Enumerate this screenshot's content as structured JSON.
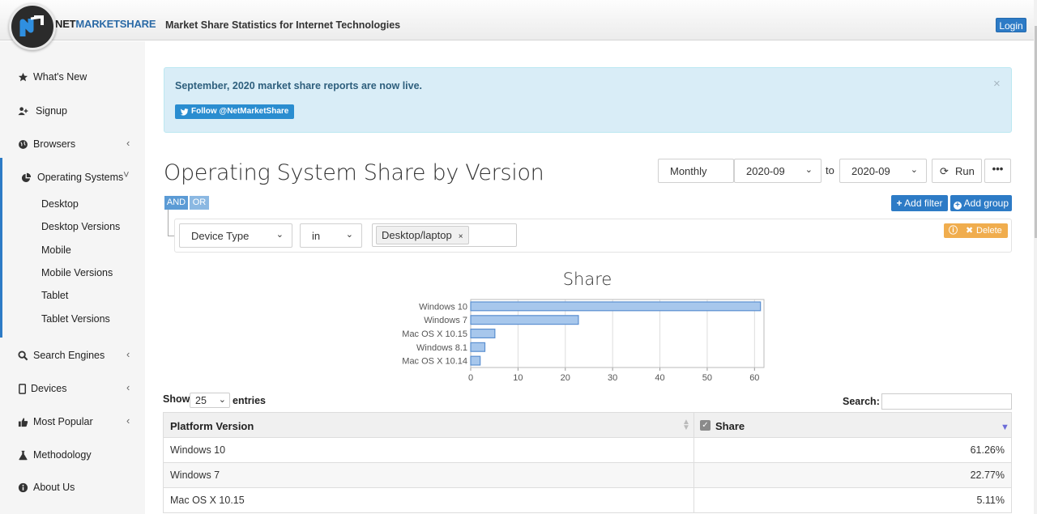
{
  "header": {
    "logo_net": "NET",
    "logo_ms": "MARKETSHARE",
    "tagline": "Market Share Statistics for Internet Technologies",
    "login": "Login"
  },
  "sidebar": {
    "items": [
      {
        "label": "What's New",
        "icon": "star-icon"
      },
      {
        "label": "Signup",
        "icon": "user-plus-icon"
      },
      {
        "label": "Browsers",
        "icon": "globe-icon"
      },
      {
        "label": "Operating Systems",
        "icon": "pie-chart-icon"
      },
      {
        "label": "Search Engines",
        "icon": "search-icon"
      },
      {
        "label": "Devices",
        "icon": "tablet-icon"
      },
      {
        "label": "Most Popular",
        "icon": "thumbs-up-icon"
      },
      {
        "label": "Methodology",
        "icon": "flask-icon"
      },
      {
        "label": "About Us",
        "icon": "info-icon"
      }
    ],
    "os_subitems": [
      "Desktop",
      "Desktop Versions",
      "Mobile",
      "Mobile Versions",
      "Tablet",
      "Tablet Versions"
    ]
  },
  "alert": {
    "message": "September, 2020 market share reports are now live.",
    "follow": "Follow @NetMarketShare",
    "close": "×"
  },
  "report": {
    "title": "Operating System Share by Version",
    "period": "Monthly",
    "from": "2020-09",
    "to_label": "to",
    "to": "2020-09",
    "run": "Run",
    "more": "•••"
  },
  "filter": {
    "and": "AND",
    "or": "OR",
    "add_filter": "Add filter",
    "add_group": "Add group",
    "field": "Device Type",
    "operator": "in",
    "value_tag": "Desktop/laptop",
    "tag_remove": "×",
    "delete": "Delete"
  },
  "chart_data": {
    "type": "bar",
    "orientation": "horizontal",
    "title": "Share",
    "categories": [
      "Windows 10",
      "Windows 7",
      "Mac OS X 10.15",
      "Windows 8.1",
      "Mac OS X 10.14"
    ],
    "values": [
      61.26,
      22.77,
      5.11,
      3.0,
      2.0
    ],
    "xlim": [
      0,
      62
    ],
    "xticks": [
      0,
      10,
      20,
      30,
      40,
      50,
      60
    ],
    "grid": true,
    "color": "#a7c7ec",
    "edge_color": "#5b8fd0"
  },
  "table": {
    "show_label": "Show",
    "show_value": "25",
    "entries_label": "entries",
    "search_label": "Search:",
    "col_platform": "Platform Version",
    "col_share": "Share",
    "rows": [
      {
        "platform": "Windows 10",
        "share": "61.26%"
      },
      {
        "platform": "Windows 7",
        "share": "22.77%"
      },
      {
        "platform": "Mac OS X 10.15",
        "share": "5.11%"
      }
    ]
  }
}
